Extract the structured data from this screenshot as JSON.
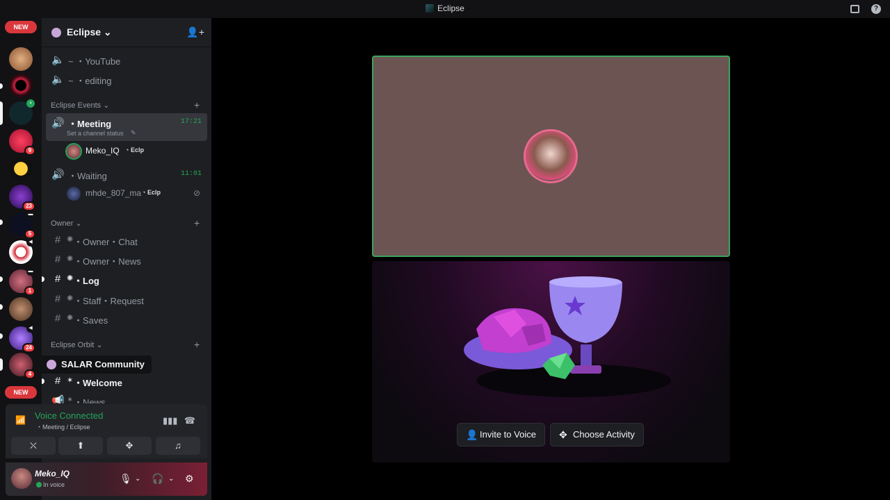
{
  "window": {
    "title": "Eclipse"
  },
  "rail": {
    "new_label_top": "NEW",
    "new_label_bottom": "NEW",
    "servers": [
      {
        "name": "server-1",
        "color": "#c88c5a",
        "badge": ""
      },
      {
        "name": "server-2",
        "color": "#3a1010",
        "badge": ""
      },
      {
        "name": "server-eclipse",
        "color": "#10282b",
        "badge": ""
      },
      {
        "name": "server-4",
        "color": "#c2203a",
        "badge": "9"
      },
      {
        "name": "server-5",
        "color": "#d8a21a",
        "badge": ""
      },
      {
        "name": "server-6",
        "color": "#3b1b6b",
        "badge": "23"
      },
      {
        "name": "server-7",
        "color": "#101320",
        "badge": "5"
      },
      {
        "name": "server-8",
        "color": "#e8e8e8",
        "badge": ""
      },
      {
        "name": "server-9",
        "color": "#7a3040",
        "badge": "1"
      },
      {
        "name": "server-10",
        "color": "#6b5445",
        "badge": ""
      },
      {
        "name": "server-11",
        "color": "#4a2a8a",
        "badge": "24"
      },
      {
        "name": "server-salar",
        "color": "#5a2030",
        "badge": "4"
      }
    ]
  },
  "guild": {
    "name": "Eclipse"
  },
  "channels": {
    "youtube": "~ ・YouTube",
    "editing": "~ ・editing",
    "cat_events": "Eclipse Events",
    "meeting": "・Meeting",
    "meeting_status": "Set a channel status",
    "meeting_time": "17:21",
    "meeting_user": "Meko_IQ",
    "meeting_user_tag": "Eclp",
    "waiting": "・Waiting",
    "waiting_time": "11:01",
    "waiting_user": "mhde_807_ma",
    "waiting_user_tag": "Eclp",
    "cat_owner": "Owner",
    "owner_chat": "・Owner・Chat",
    "owner_news": "・Owner・News",
    "log": "・Log",
    "staff_request": "・Staff・Request",
    "saves": "・Saves",
    "cat_orbit": "Eclipse Orbit",
    "welcome": "・Welcome",
    "news": "・News"
  },
  "tooltip": {
    "text": "SALAR Community"
  },
  "voice": {
    "status": "Voice Connected",
    "location": "・Meeting / Eclipse"
  },
  "user": {
    "name": "Meko_IQ",
    "status": "In voice"
  },
  "main": {
    "invite_label": "Invite to Voice",
    "activity_label": "Choose Activity"
  },
  "colors": {
    "accent_green": "#23a55a",
    "speaking_border": "#3ba55d",
    "danger": "#da373c"
  }
}
